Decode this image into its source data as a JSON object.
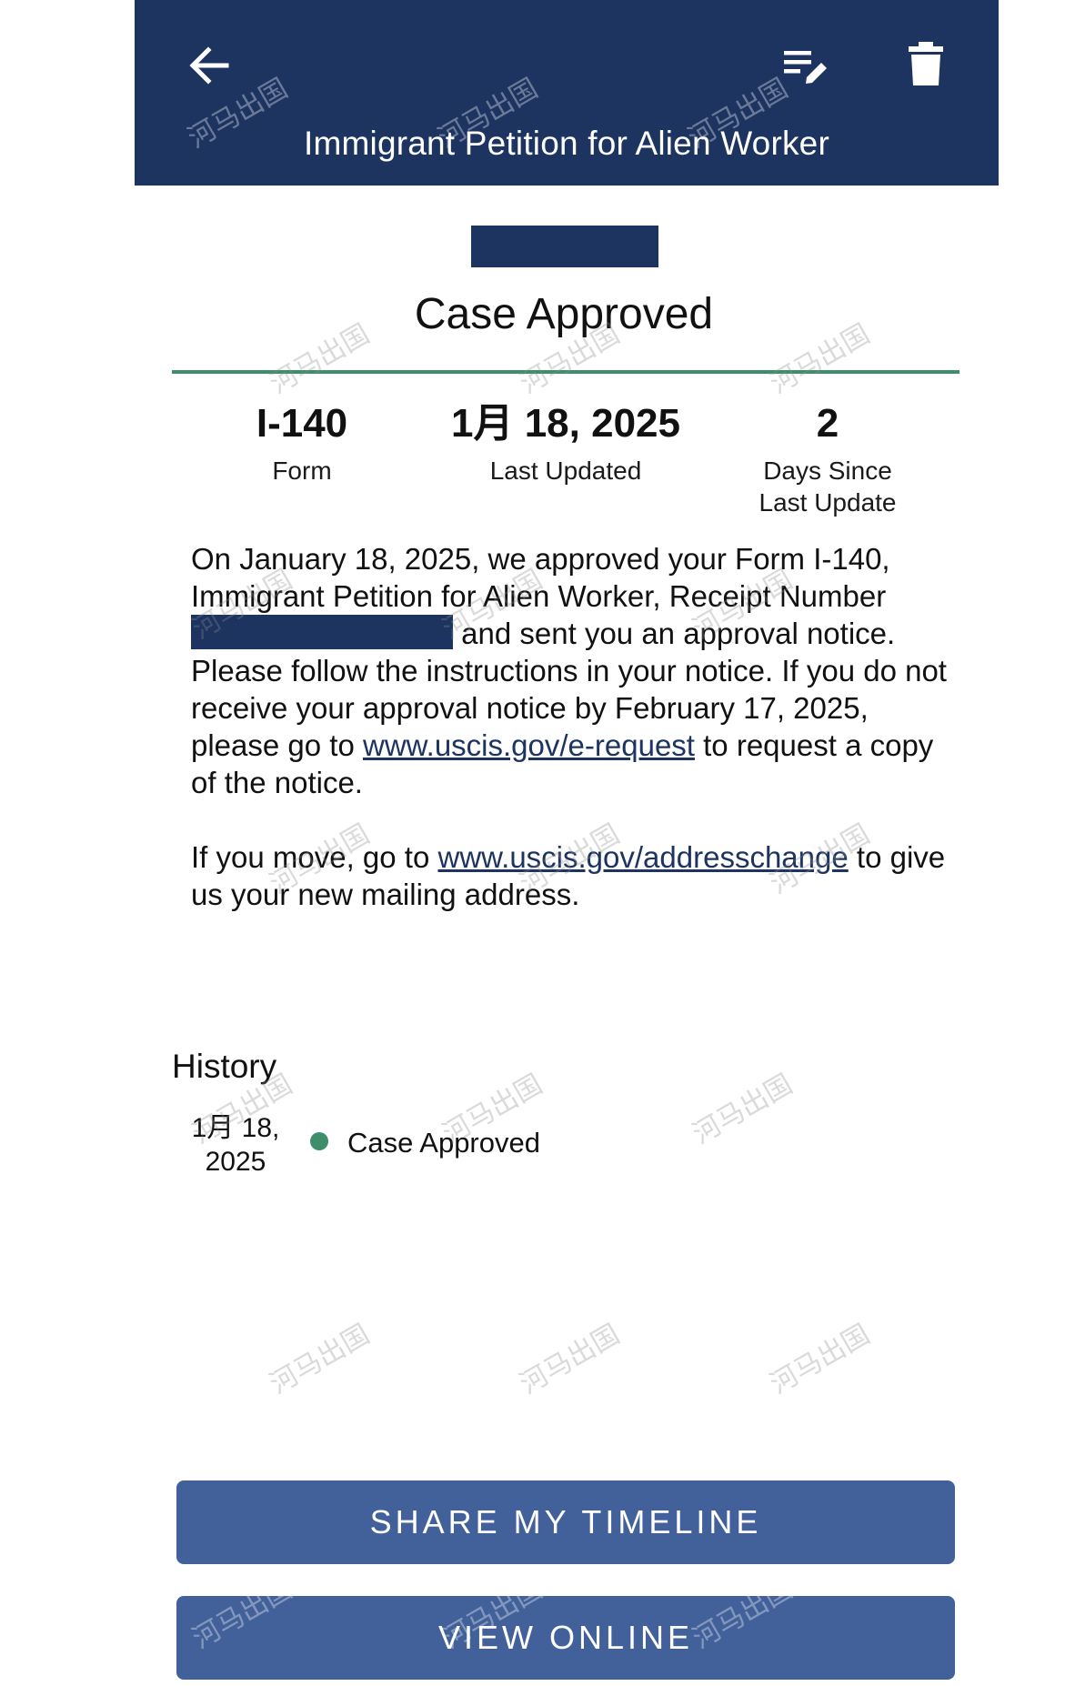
{
  "colors": {
    "header_bg": "#1d3461",
    "accent": "#3d8f6b",
    "button": "#42619b",
    "redaction": "#1d3461"
  },
  "header": {
    "title": "Immigrant Petition for Alien Worker",
    "back_icon": "arrow-left-icon",
    "edit_icon": "list-edit-icon",
    "delete_icon": "trash-icon"
  },
  "case": {
    "status": "Case Approved"
  },
  "stats": [
    {
      "value": "I-140",
      "label": "Form"
    },
    {
      "value": "1月 18, 2025",
      "label": "Last Updated"
    },
    {
      "value": "2",
      "label": "Days Since\nLast Update"
    }
  ],
  "message": {
    "p1_part1": "On January 18, 2025, we approved your Form I-140, Immigrant Petition for Alien Worker, Receipt Number",
    "p1_part2": "and sent you an approval notice. Please follow the instructions in your notice. If you do not receive your approval notice by February 17, 2025, please go to ",
    "link1": "www.uscis.gov/e-request",
    "p1_part3": " to request a copy of the notice.",
    "p2_part1": "If you move, go to ",
    "link2": "www.uscis.gov/addresschange",
    "p2_part2": " to give us your new mailing address."
  },
  "history": {
    "heading": "History",
    "items": [
      {
        "date": "1月 18,\n2025",
        "status": "Case Approved"
      }
    ]
  },
  "buttons": {
    "share": "SHARE MY TIMELINE",
    "view_online": "VIEW ONLINE"
  },
  "watermark": "河马出国"
}
